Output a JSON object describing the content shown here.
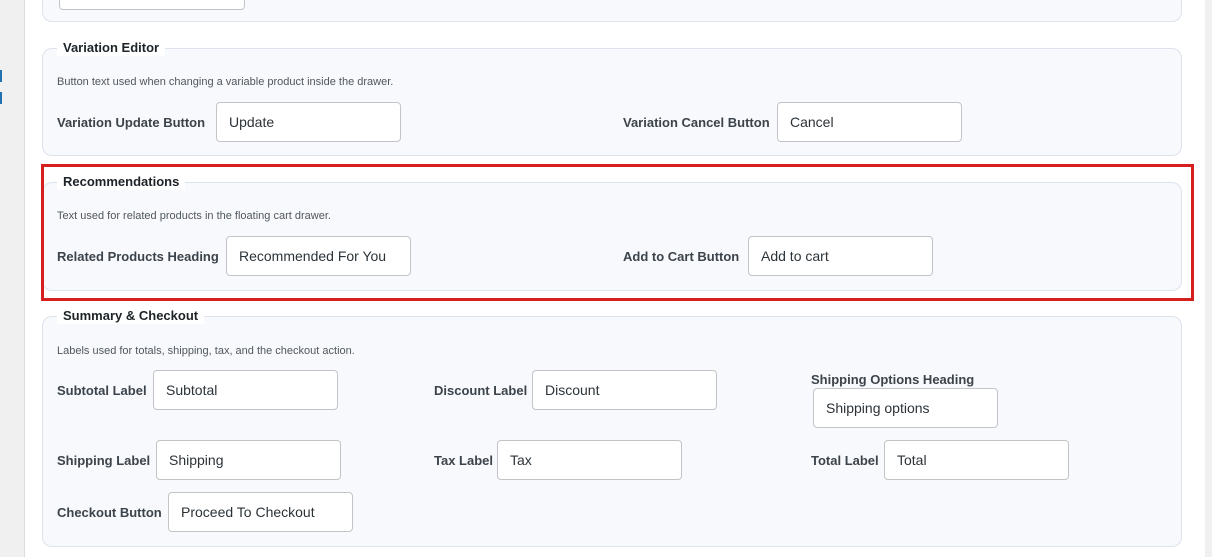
{
  "colors": {
    "highlight": "#d61f1f",
    "section_bg": "#f7f9fc",
    "section_border": "#dde3ec"
  },
  "sections": {
    "variation": {
      "title": "Variation Editor",
      "description": "Button text used when changing a variable product inside the drawer.",
      "fields": {
        "update": {
          "label": "Variation Update Button",
          "value": "Update"
        },
        "cancel": {
          "label": "Variation Cancel Button",
          "value": "Cancel"
        }
      }
    },
    "recommendations": {
      "title": "Recommendations",
      "description": "Text used for related products in the floating cart drawer.",
      "fields": {
        "heading": {
          "label": "Related Products Heading",
          "value": "Recommended For You"
        },
        "add_to_cart": {
          "label": "Add to Cart Button",
          "value": "Add to cart"
        }
      }
    },
    "summary": {
      "title": "Summary & Checkout",
      "description": "Labels used for totals, shipping, tax, and the checkout action.",
      "fields": {
        "subtotal": {
          "label": "Subtotal Label",
          "value": "Subtotal"
        },
        "discount": {
          "label": "Discount Label",
          "value": "Discount"
        },
        "shipping_options": {
          "label": "Shipping Options Heading",
          "value": "Shipping options"
        },
        "shipping": {
          "label": "Shipping Label",
          "value": "Shipping"
        },
        "tax": {
          "label": "Tax Label",
          "value": "Tax"
        },
        "total": {
          "label": "Total Label",
          "value": "Total"
        },
        "checkout": {
          "label": "Checkout Button",
          "value": "Proceed To Checkout"
        }
      }
    }
  }
}
